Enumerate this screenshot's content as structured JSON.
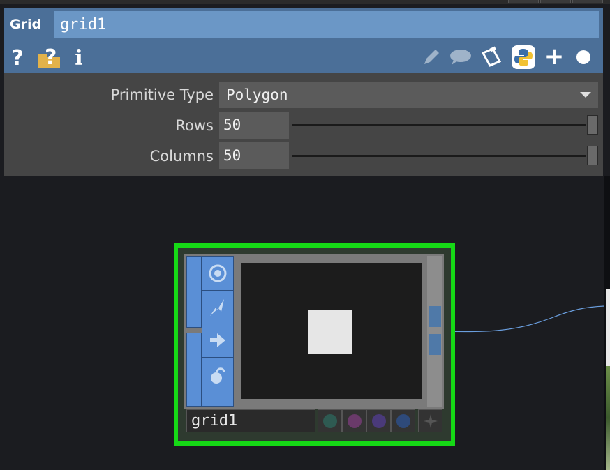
{
  "header": {
    "op_type": "Grid",
    "op_name": "grid1",
    "left_icons": [
      "help-icon",
      "operator-help-icon",
      "info-icon"
    ],
    "right_icons": [
      "pencil-icon",
      "comment-icon",
      "clipboard-icon",
      "python-icon",
      "plus-icon",
      "circle-icon"
    ]
  },
  "params": {
    "primitive_type": {
      "label": "Primitive Type",
      "value": "Polygon"
    },
    "rows": {
      "label": "Rows",
      "value": "50",
      "slider_fraction": 1.0
    },
    "columns": {
      "label": "Columns",
      "value": "50",
      "slider_fraction": 1.0
    }
  },
  "node": {
    "name": "grid1",
    "flag_icons": [
      "viewer-flag-icon",
      "bypass-flag-icon",
      "display-flag-icon",
      "lock-flag-icon"
    ],
    "dot_colors": [
      "#2e5a52",
      "#6a3a6a",
      "#4a3a7a",
      "#2e4a7a"
    ],
    "border_color": "#16d916"
  }
}
